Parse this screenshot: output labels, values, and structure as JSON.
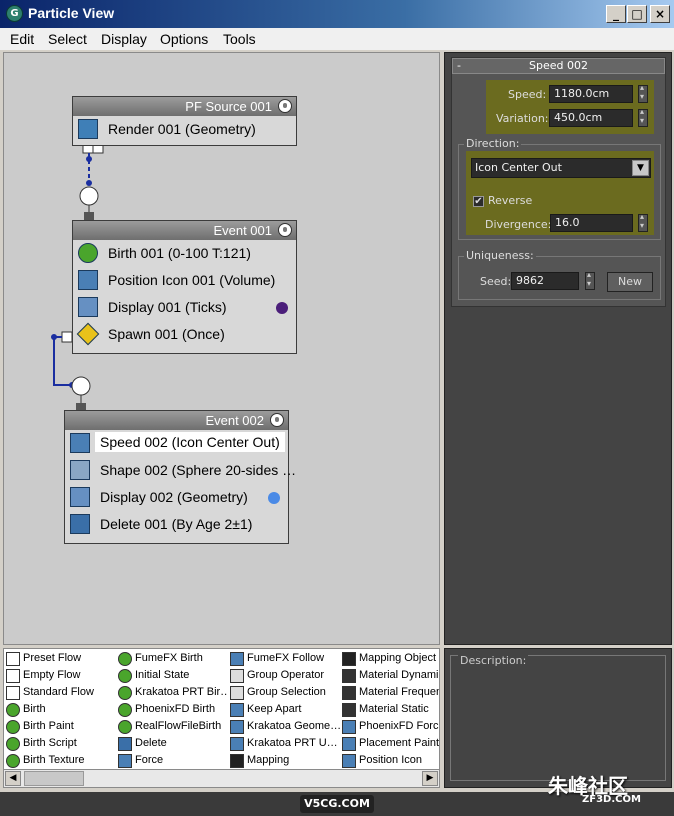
{
  "window": {
    "title": "Particle View",
    "minimize_glyph": "_",
    "maximize_glyph": "□",
    "close_glyph": "×",
    "icon_letter": "G"
  },
  "menu": [
    "Edit",
    "Select",
    "Display",
    "Options",
    "Tools"
  ],
  "nodes": {
    "source": {
      "title": "PF Source 001",
      "ops": [
        {
          "label": "Render 001 (Geometry)",
          "icon": "render-icon"
        }
      ]
    },
    "event1": {
      "title": "Event 001",
      "ops": [
        {
          "label": "Birth 001 (0-100 T:121)",
          "icon": "birth-icon"
        },
        {
          "label": "Position Icon 001 (Volume)",
          "icon": "position-icon"
        },
        {
          "label": "Display 001 (Ticks)",
          "icon": "display-icon",
          "dot_color": "#4b1e7a"
        },
        {
          "label": "Spawn 001 (Once)",
          "icon": "spawn-icon"
        }
      ]
    },
    "event2": {
      "title": "Event 002",
      "ops": [
        {
          "label": "Speed 002 (Icon Center Out)",
          "icon": "speed-icon",
          "selected": true
        },
        {
          "label": "Shape 002 (Sphere 20-sides …",
          "icon": "shape-icon"
        },
        {
          "label": "Display 002 (Geometry)",
          "icon": "display-icon",
          "dot_color": "#4a8ae6"
        },
        {
          "label": "Delete 001 (By Age 2±1)",
          "icon": "delete-icon"
        }
      ]
    }
  },
  "params": {
    "rollout_title": "Speed 002",
    "collapse_glyph": "-",
    "speed_label": "Speed:",
    "speed_value": "1180.0cm",
    "variation_label": "Variation:",
    "variation_value": "450.0cm",
    "direction_label": "Direction:",
    "direction_value": "Icon Center Out",
    "reverse_label": "Reverse",
    "reverse_checked": "✔",
    "divergence_label": "Divergence:",
    "divergence_value": "16.0",
    "uniqueness_label": "Uniqueness:",
    "seed_label": "Seed:",
    "seed_value": "9862",
    "new_label": "New"
  },
  "depot": {
    "columns": [
      [
        "Preset Flow",
        "Empty Flow",
        "Standard Flow",
        "Birth",
        "Birth Paint",
        "Birth Script",
        "Birth Texture"
      ],
      [
        "FumeFX Birth",
        "Initial State",
        "Krakatoa PRT Bir…",
        "PhoenixFD Birth",
        "RealFlowFileBirth",
        "Delete",
        "Force"
      ],
      [
        "FumeFX Follow",
        "Group Operator",
        "Group Selection",
        "Keep Apart",
        "Krakatoa Geome…",
        "Krakatoa PRT U…",
        "Mapping"
      ],
      [
        "Mapping Object",
        "Material Dynamic",
        "Material Frequen",
        "Material Static",
        "PhoenixFD Force",
        "Placement Paint",
        "Position Icon"
      ]
    ]
  },
  "description": {
    "title": "Description:"
  },
  "watermarks": {
    "site": "V5CG.COM",
    "brand": "朱峰社区",
    "brand_url": "ZF3D.COM"
  },
  "colors": {
    "highlight": "#6b6b1f",
    "wire": "#1a2ea0",
    "selected_dot": "#4a8ae6",
    "display_dot": "#4b1e7a"
  }
}
